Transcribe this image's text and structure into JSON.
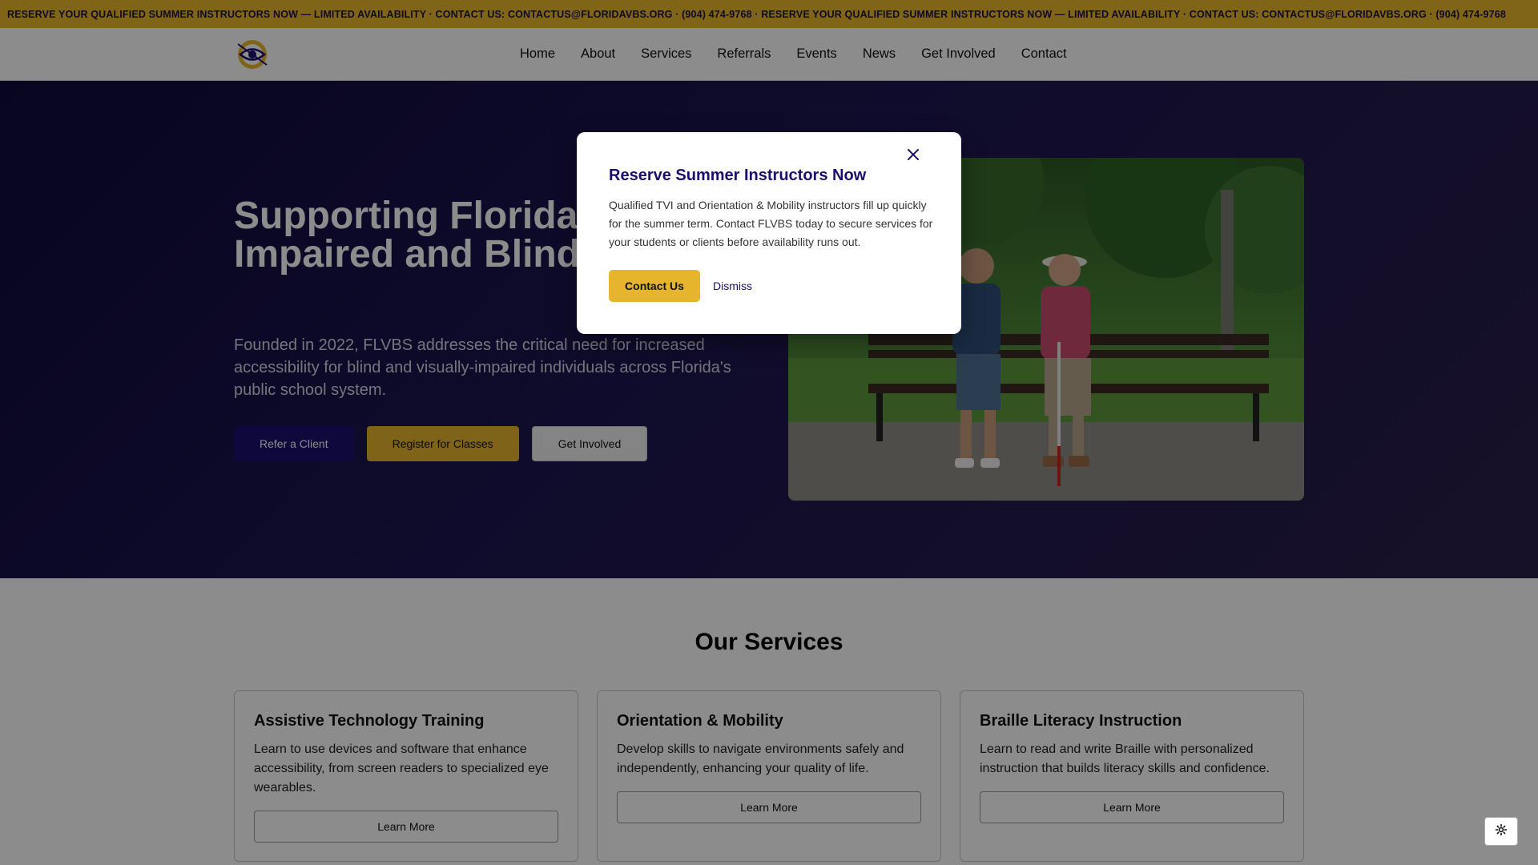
{
  "ticker": {
    "text": "RESERVE YOUR QUALIFIED SUMMER INSTRUCTORS NOW — LIMITED AVAILABILITY · CONTACT US: CONTACTUS@FLORIDAVBS.ORG · (904) 474-9768 · RESERVE YOUR QUALIFIED SUMMER INSTRUCTORS NOW — LIMITED AVAILABILITY · CONTACT US: CONTACTUS@FLORIDAVBS.ORG · (904) 474-9768"
  },
  "nav": {
    "items": [
      "Home",
      "About",
      "Services",
      "Referrals",
      "Events",
      "News",
      "Get Involved",
      "Contact"
    ]
  },
  "hero": {
    "title": "Supporting Florida's Visually Impaired and Blind Community",
    "subtitle": "Founded in 2022, FLVBS addresses the critical need for increased accessibility for blind and visually-impaired individuals across Florida's public school system.",
    "buttons": {
      "refer": "Refer a Client",
      "register": "Register for Classes",
      "involved": "Get Involved"
    }
  },
  "services": {
    "title": "Our Services",
    "cards": [
      {
        "title": "Assistive Technology Training",
        "text": "Learn to use devices and software that enhance accessibility, from screen readers to specialized eye wearables.",
        "button": "Learn More"
      },
      {
        "title": "Orientation & Mobility",
        "text": "Develop skills to navigate environments safely and independently, enhancing your quality of life.",
        "button": "Learn More"
      },
      {
        "title": "Braille Literacy Instruction",
        "text": "Learn to read and write Braille with personalized instruction that builds literacy skills and confidence.",
        "button": "Learn More"
      }
    ]
  },
  "modal": {
    "title": "Reserve Summer Instructors Now",
    "text": "Qualified TVI and Orientation & Mobility instructors fill up quickly for the summer term. Contact FLVBS today to secure services for your students or clients before availability runs out.",
    "contact_label": "Contact Us",
    "dismiss_label": "Dismiss"
  },
  "colors": {
    "accent_gold": "#e7b42d",
    "brand_navy": "#1a0f6e"
  },
  "icons": {
    "logo": "flvbs-eye-logo",
    "close": "close-icon",
    "settings": "gear-icon"
  }
}
